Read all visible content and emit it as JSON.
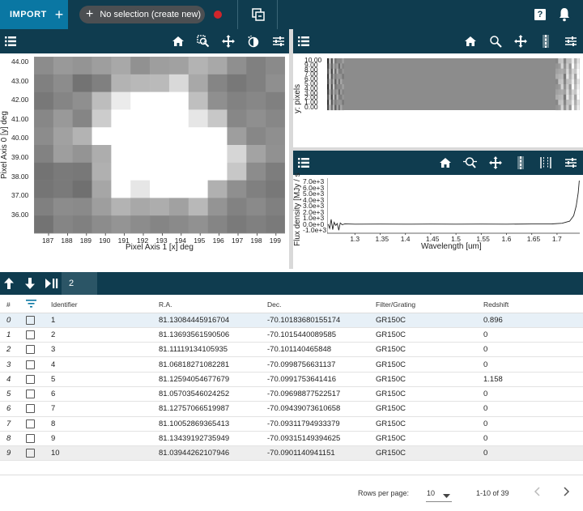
{
  "appbar": {
    "import_label": "IMPORT",
    "selection_label": "No selection (create new)",
    "help_label": "?"
  },
  "viewer_image": {
    "ylabel": "Pixel Axis 0 [y] deg",
    "xlabel": "Pixel Axis 1 [x] deg",
    "yticks": [
      "44.00",
      "43.00",
      "42.00",
      "41.00",
      "40.00",
      "39.00",
      "38.00",
      "37.00",
      "36.00"
    ],
    "xticks": [
      "187",
      "188",
      "189",
      "190",
      "191",
      "192",
      "193",
      "194",
      "195",
      "196",
      "197",
      "198",
      "199"
    ]
  },
  "viewer_spec2d": {
    "ylabel": "y: pixels",
    "yticks": [
      "10.00",
      "9.00",
      "8.00",
      "7.00",
      "6.00",
      "5.00",
      "4.00",
      "3.00",
      "2.00",
      "1.00",
      "0.00"
    ]
  },
  "viewer_spec1d": {
    "ylabel": "Flux density [MJy / s",
    "xlabel": "Wavelength [um]",
    "yticks": [
      "7.0e+3",
      "6.0e+3",
      "5.0e+3",
      "4.0e+3",
      "3.0e+3",
      "2.0e+3",
      "1.0e+3",
      "0.0e+0",
      "-1.0e+3"
    ],
    "xticks": [
      "1.3",
      "1.35",
      "1.4",
      "1.45",
      "1.5",
      "1.55",
      "1.6",
      "1.65",
      "1.7"
    ]
  },
  "table": {
    "count": "2",
    "headers": [
      "#",
      "",
      "Identifier",
      "R.A.",
      "Dec.",
      "Filter/Grating",
      "Redshift"
    ],
    "rows": [
      {
        "idx": "0",
        "id": "1",
        "ra": "81.13084445916704",
        "dec": "-70.10183680155174",
        "filter": "GR150C",
        "z": "0.896"
      },
      {
        "idx": "1",
        "id": "2",
        "ra": "81.13693561590506",
        "dec": "-70.1015440089585",
        "filter": "GR150C",
        "z": "0"
      },
      {
        "idx": "2",
        "id": "3",
        "ra": "81.11119134105935",
        "dec": "-70.101140465848",
        "filter": "GR150C",
        "z": "0"
      },
      {
        "idx": "3",
        "id": "4",
        "ra": "81.06818271082281",
        "dec": "-70.0998756631137",
        "filter": "GR150C",
        "z": "0"
      },
      {
        "idx": "4",
        "id": "5",
        "ra": "81.12594054677679",
        "dec": "-70.0991753641416",
        "filter": "GR150C",
        "z": "1.158"
      },
      {
        "idx": "5",
        "id": "6",
        "ra": "81.05703546024252",
        "dec": "-70.09698877522517",
        "filter": "GR150C",
        "z": "0"
      },
      {
        "idx": "6",
        "id": "7",
        "ra": "81.12757066519987",
        "dec": "-70.09439073610658",
        "filter": "GR150C",
        "z": "0"
      },
      {
        "idx": "7",
        "id": "8",
        "ra": "81.10052869365413",
        "dec": "-70.09311794933379",
        "filter": "GR150C",
        "z": "0"
      },
      {
        "idx": "8",
        "id": "9",
        "ra": "81.13439192735949",
        "dec": "-70.09315149394625",
        "filter": "GR150C",
        "z": "0"
      },
      {
        "idx": "9",
        "id": "10",
        "ra": "81.03944262107946",
        "dec": "-70.0901140941151",
        "filter": "GR150C",
        "z": "0"
      }
    ]
  },
  "footer": {
    "rows_per_page_label": "Rows per page:",
    "rows_per_page_value": "10",
    "range_label": "1-10 of 39"
  },
  "colors": {
    "appbar": "#0f3c4f",
    "import": "#0a77a3",
    "record": "#d0252b",
    "selected_row": "#e7f0f7"
  }
}
